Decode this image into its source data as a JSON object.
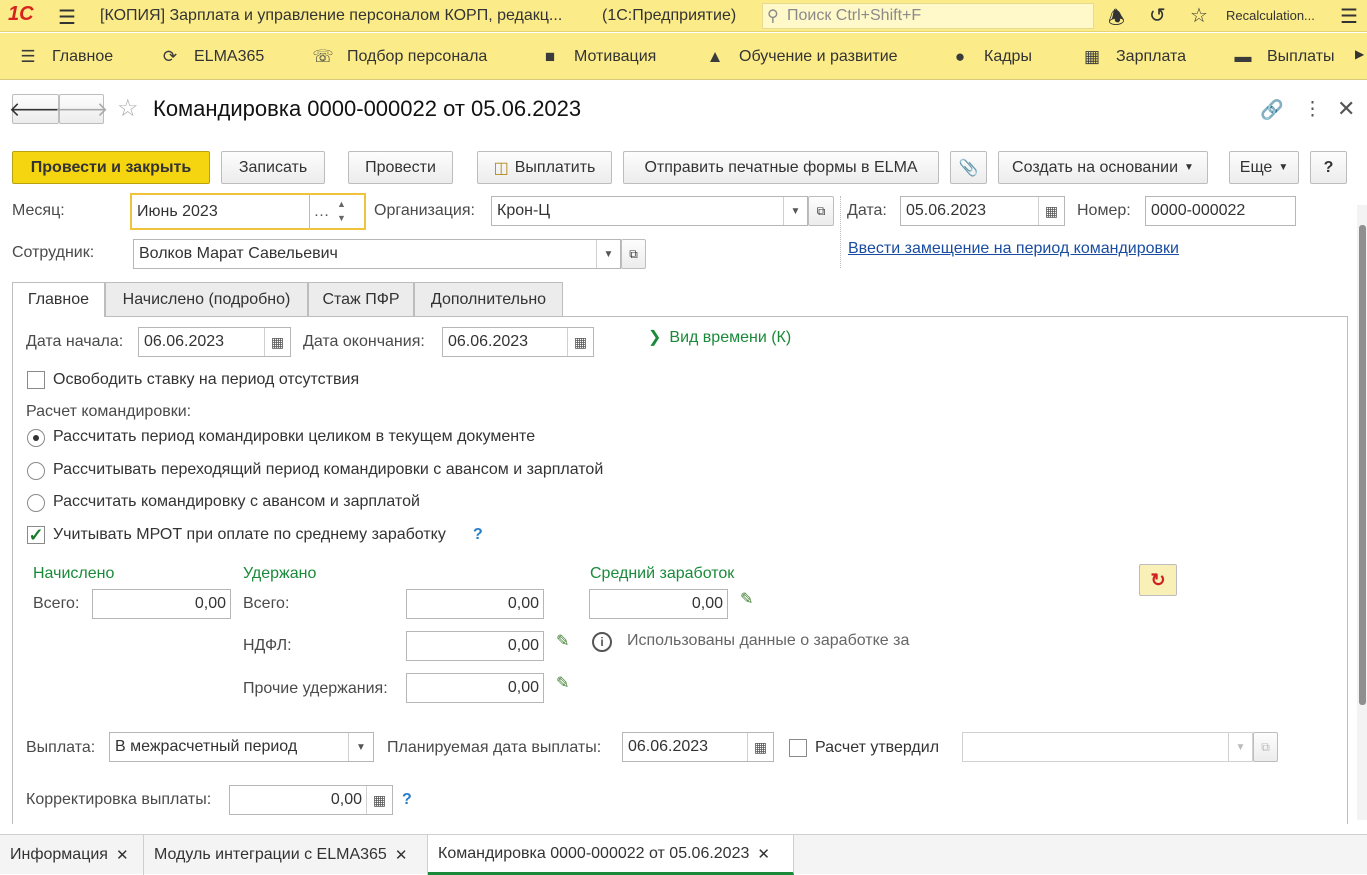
{
  "titlebar": {
    "logo": "1С",
    "title": "[КОПИЯ] Зарплата и управление персоналом КОРП, редакц...",
    "app": "(1С:Предприятие)",
    "search_placeholder": "Поиск Ctrl+Shift+F",
    "user": "Recalculation..."
  },
  "sections": [
    {
      "label": "Главное",
      "icon": "menu-icon"
    },
    {
      "label": "ELMA365",
      "icon": "elma-icon"
    },
    {
      "label": "Подбор персонала",
      "icon": "headset-icon"
    },
    {
      "label": "Мотивация",
      "icon": "gift-icon"
    },
    {
      "label": "Обучение и развитие",
      "icon": "graduation-cap-icon"
    },
    {
      "label": "Кадры",
      "icon": "people-icon"
    },
    {
      "label": "Зарплата",
      "icon": "calculator-icon"
    },
    {
      "label": "Выплаты",
      "icon": "wallet-icon"
    }
  ],
  "document": {
    "title": "Командировка 0000-000022 от 05.06.2023"
  },
  "toolbar": {
    "post_close": "Провести и закрыть",
    "save": "Записать",
    "post": "Провести",
    "pay": "Выплатить",
    "send_elma": "Отправить печатные формы в ELMA",
    "create_based": "Создать на основании",
    "more": "Еще",
    "help": "?"
  },
  "header": {
    "month_label": "Месяц:",
    "month_value": "Июнь 2023",
    "org_label": "Организация:",
    "org_value": "Крон-Ц",
    "date_label": "Дата:",
    "date_value": "05.06.2023",
    "number_label": "Номер:",
    "number_value": "0000-000022",
    "employee_label": "Сотрудник:",
    "employee_value": "Волков Марат Савельевич",
    "replacement_link": "Ввести замещение на период командировки"
  },
  "tabs": [
    "Главное",
    "Начислено (подробно)",
    "Стаж ПФР",
    "Дополнительно"
  ],
  "main": {
    "start_label": "Дата начала:",
    "start_value": "06.06.2023",
    "end_label": "Дата окончания:",
    "end_value": "06.06.2023",
    "time_type": "Вид времени (К)",
    "free_rate": "Освободить ставку на период отсутствия",
    "calc_label": "Расчет командировки:",
    "radio_options": [
      "Рассчитать период командировки целиком в текущем документе",
      "Рассчитывать переходящий период командировки с авансом и зарплатой",
      "Рассчитать командировку с авансом и зарплатой"
    ],
    "radio_selected": 0,
    "mrot": "Учитывать МРОТ при оплате по среднему заработку",
    "mrot_checked": true,
    "accrued_head": "Начислено",
    "withheld_head": "Удержано",
    "avg_head": "Средний заработок",
    "total_label": "Всего:",
    "accrued_total": "0,00",
    "withheld_total_label": "Всего:",
    "withheld_total": "0,00",
    "ndfl_label": "НДФЛ:",
    "ndfl": "0,00",
    "other_label": "Прочие удержания:",
    "other": "0,00",
    "avg_value": "0,00",
    "info_text": "Использованы данные о заработке за",
    "payout_label": "Выплата:",
    "payout_value": "В межрасчетный период",
    "planned_label": "Планируемая дата выплаты:",
    "planned_value": "06.06.2023",
    "approved_label": "Расчет утвердил",
    "approved_value": "",
    "correction_label": "Корректировка выплаты:",
    "correction_value": "0,00"
  },
  "bottom_tabs": [
    "Информация",
    "Модуль интеграции с ELMA365",
    "Командировка 0000-000022 от 05.06.2023"
  ],
  "colors": {
    "accent": "#f5d50f",
    "panel": "#fbec89",
    "green": "#1a8a3a",
    "link": "#1a4da1"
  }
}
